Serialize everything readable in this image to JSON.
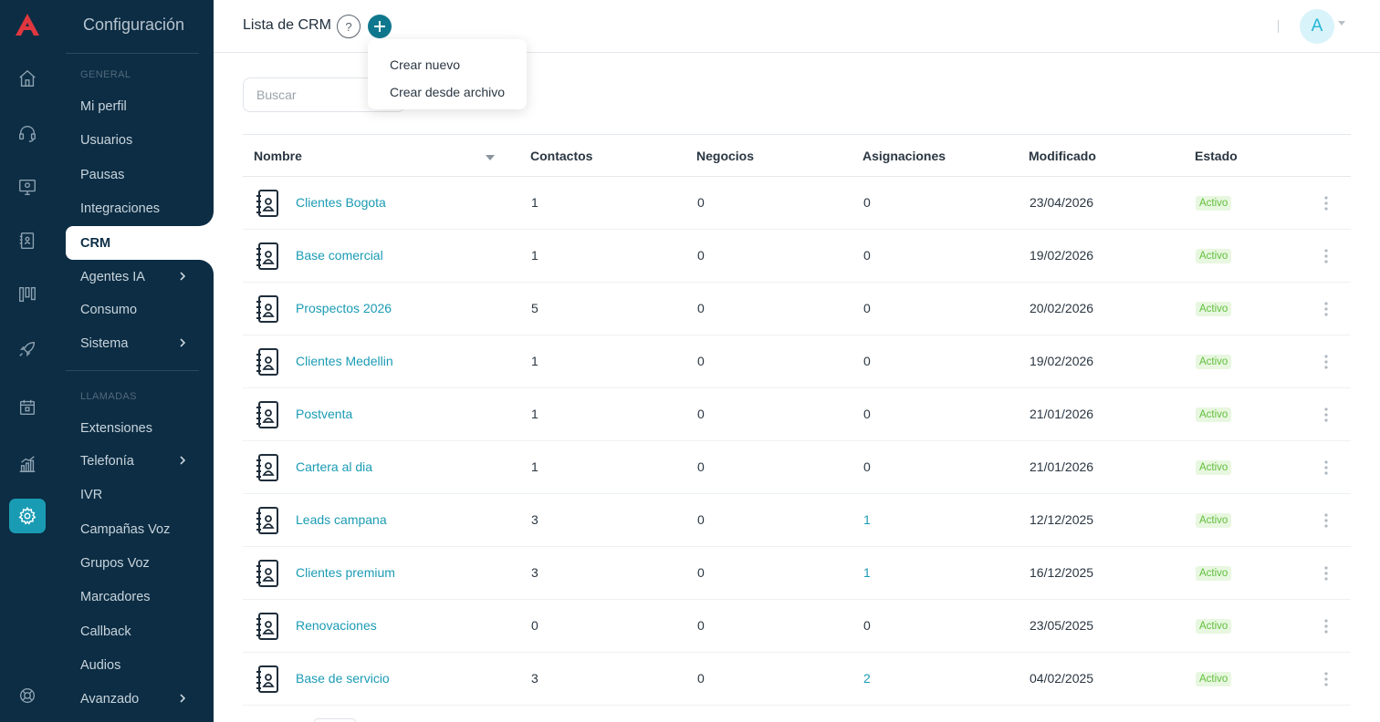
{
  "sidebar": {
    "title": "Configuración",
    "section_general": "GENERAL",
    "section_calls": "LLAMADAS",
    "items": [
      {
        "label": "Mi perfil"
      },
      {
        "label": "Usuarios"
      },
      {
        "label": "Pausas"
      },
      {
        "label": "Integraciones"
      },
      {
        "label": "CRM"
      },
      {
        "label": "Agentes IA"
      },
      {
        "label": "Consumo"
      },
      {
        "label": "Sistema"
      },
      {
        "label": "Extensiones"
      },
      {
        "label": "Telefonía"
      },
      {
        "label": "IVR"
      },
      {
        "label": "Campañas Voz"
      },
      {
        "label": "Grupos Voz"
      },
      {
        "label": "Marcadores"
      },
      {
        "label": "Callback"
      },
      {
        "label": "Audios"
      },
      {
        "label": "Avanzado"
      }
    ]
  },
  "header": {
    "title": "Lista de CRM",
    "help_label": "?",
    "avatar_initial": "A"
  },
  "dropdown": {
    "options": [
      "Crear nuevo",
      "Crear desde archivo"
    ]
  },
  "search": {
    "placeholder": "Buscar"
  },
  "table": {
    "columns": [
      "Nombre",
      "Contactos",
      "Negocios",
      "Asignaciones",
      "Modificado",
      "Estado"
    ],
    "rows": [
      {
        "name": "Clientes Bogota",
        "contacts": "1",
        "deals": "0",
        "assignments": "0",
        "modified": "23/04/2026",
        "status": "Activo"
      },
      {
        "name": "Base comercial",
        "contacts": "1",
        "deals": "0",
        "assignments": "0",
        "modified": "19/02/2026",
        "status": "Activo"
      },
      {
        "name": "Prospectos 2026",
        "contacts": "5",
        "deals": "0",
        "assignments": "0",
        "modified": "20/02/2026",
        "status": "Activo"
      },
      {
        "name": "Clientes Medellin",
        "contacts": "1",
        "deals": "0",
        "assignments": "0",
        "modified": "19/02/2026",
        "status": "Activo"
      },
      {
        "name": "Postventa",
        "contacts": "1",
        "deals": "0",
        "assignments": "0",
        "modified": "21/01/2026",
        "status": "Activo"
      },
      {
        "name": "Cartera al dia",
        "contacts": "1",
        "deals": "0",
        "assignments": "0",
        "modified": "21/01/2026",
        "status": "Activo"
      },
      {
        "name": "Leads campana",
        "contacts": "3",
        "deals": "0",
        "assignments": "1",
        "modified": "12/12/2025",
        "status": "Activo"
      },
      {
        "name": "Clientes premium",
        "contacts": "3",
        "deals": "0",
        "assignments": "1",
        "modified": "16/12/2025",
        "status": "Activo"
      },
      {
        "name": "Renovaciones",
        "contacts": "0",
        "deals": "0",
        "assignments": "0",
        "modified": "23/05/2025",
        "status": "Activo"
      },
      {
        "name": "Base de servicio",
        "contacts": "3",
        "deals": "0",
        "assignments": "2",
        "modified": "04/02/2025",
        "status": "Activo"
      }
    ]
  },
  "colors": {
    "sidebar_bg": "#0c2d44",
    "accent": "#1a9bb4",
    "status_green": "#61bf3c",
    "brand_red": "#e0373f"
  },
  "icons": [
    "logo-icon",
    "home-icon",
    "headset-icon",
    "monitor-icon",
    "contacts-book-icon",
    "kanban-icon",
    "rocket-icon",
    "calendar-icon",
    "reports-icon",
    "gear-icon",
    "support-icon",
    "help-icon",
    "plus-icon",
    "chevron-right-icon",
    "sort-down-icon",
    "kebab-menu-icon"
  ]
}
